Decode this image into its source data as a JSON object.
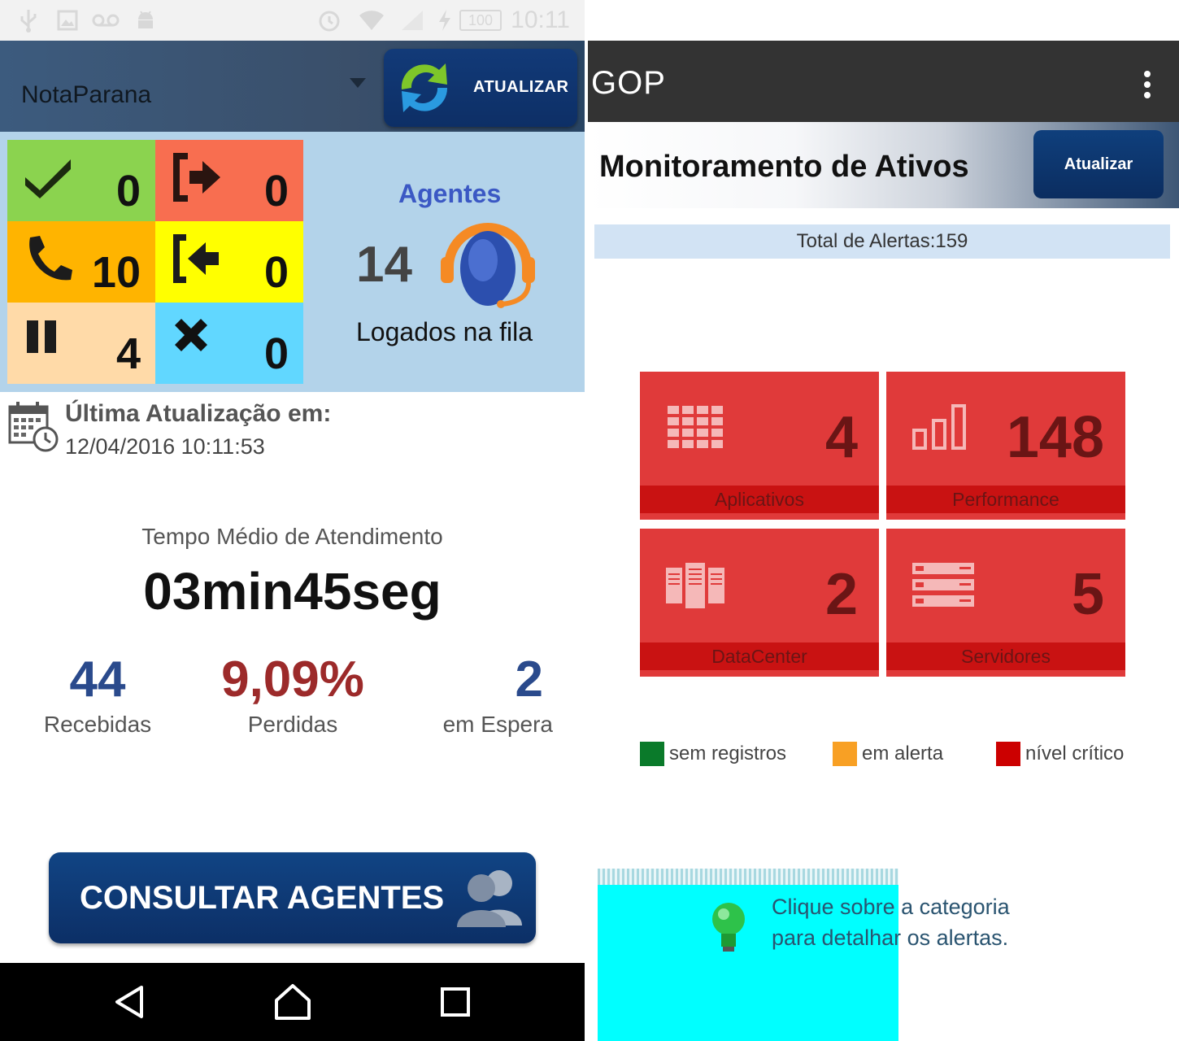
{
  "left": {
    "status_bar": {
      "battery": "100",
      "time": "10:11"
    },
    "header": {
      "queue": "NotaParana",
      "refresh_label": "ATUALIZAR"
    },
    "tiles": [
      {
        "icon": "check-icon",
        "value": "0",
        "color": "#8bd34f"
      },
      {
        "icon": "logout-icon",
        "value": "0",
        "color": "#f86e50"
      },
      {
        "icon": "phone-icon",
        "value": "10",
        "color": "#ffb400"
      },
      {
        "icon": "login-icon",
        "value": "0",
        "color": "#ffff00"
      },
      {
        "icon": "pause-icon",
        "value": "4",
        "color": "#ffdaa8"
      },
      {
        "icon": "close-icon",
        "value": "0",
        "color": "#61d7ff"
      }
    ],
    "agents": {
      "title": "Agentes",
      "count": "14",
      "label": "Logados na fila"
    },
    "last_update": {
      "title": "Última Atualização em:",
      "timestamp": "12/04/2016 10:11:53"
    },
    "tma": {
      "label": "Tempo Médio de Atendimento",
      "value": "03min45seg"
    },
    "stats": [
      {
        "value": "44",
        "label": "Recebidas",
        "color": "#2a4a8c"
      },
      {
        "value": "9,09%",
        "label": "Perdidas",
        "color": "#9c2a2a"
      },
      {
        "value": "2",
        "label": "em Espera",
        "color": "#2a4a8c"
      }
    ],
    "consult_button": "CONSULTAR AGENTES"
  },
  "right": {
    "app_name": "GOP",
    "title": "Monitoramento de Ativos",
    "refresh_label": "Atualizar",
    "total_alerts": "Total de Alertas:159",
    "categories": [
      {
        "name": "Aplicativos",
        "count": "4",
        "icon": "grid-icon"
      },
      {
        "name": "Performance",
        "count": "148",
        "icon": "bar-chart-icon"
      },
      {
        "name": "DataCenter",
        "count": "2",
        "icon": "server-rack-icon"
      },
      {
        "name": "Servidores",
        "count": "5",
        "icon": "server-stack-icon"
      }
    ],
    "legend": [
      {
        "label": "sem registros",
        "color": "#0a7a2a"
      },
      {
        "label": "em alerta",
        "color": "#f8a024"
      },
      {
        "label": "nível crítico",
        "color": "#cc0000"
      }
    ],
    "hint_line1": "Clique sobre a categoria",
    "hint_line2": "para detalhar os alertas."
  }
}
